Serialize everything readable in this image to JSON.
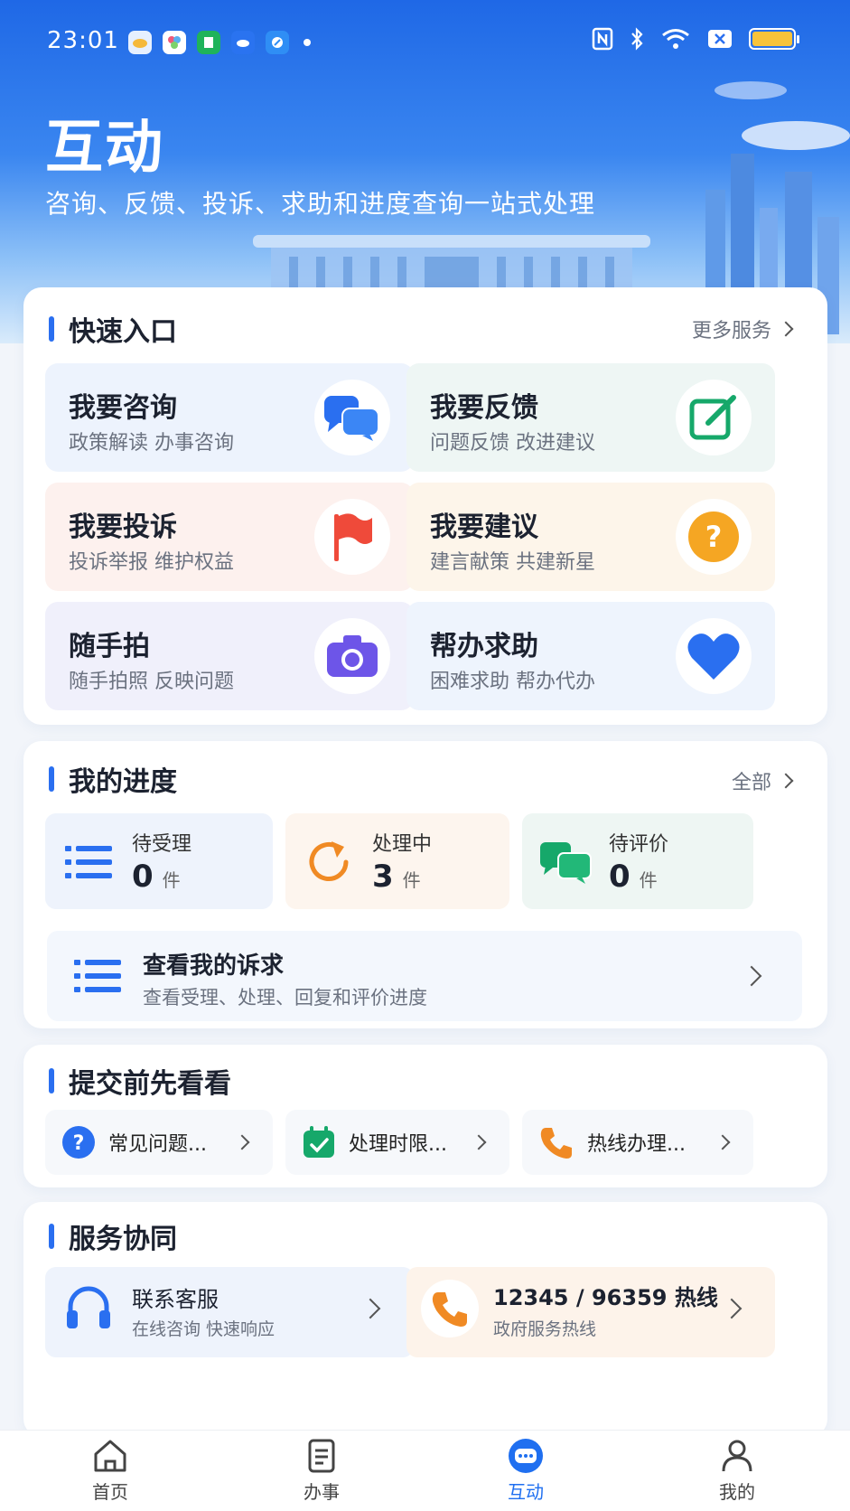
{
  "status": {
    "time": "23:01"
  },
  "header": {
    "title": "互动",
    "subtitle": "咨询、反馈、投诉、求助和进度查询一站式处理"
  },
  "quick": {
    "title": "快速入口",
    "more": "更多服务",
    "items": [
      {
        "title": "我要咨询",
        "sub": "政策解读 办事咨询",
        "icon": "chat-bubbles-icon"
      },
      {
        "title": "我要反馈",
        "sub": "问题反馈 改进建议",
        "icon": "edit-icon"
      },
      {
        "title": "我要投诉",
        "sub": "投诉举报 维护权益",
        "icon": "flag-icon"
      },
      {
        "title": "我要建议",
        "sub": "建言献策 共建新星",
        "icon": "question-icon"
      },
      {
        "title": "随手拍",
        "sub": "随手拍照 反映问题",
        "icon": "camera-icon"
      },
      {
        "title": "帮办求助",
        "sub": "困难求助 帮办代办",
        "icon": "heart-icon"
      }
    ]
  },
  "progress": {
    "title": "我的进度",
    "more": "全部",
    "unit": "件",
    "items": [
      {
        "label": "待受理",
        "count": "0"
      },
      {
        "label": "处理中",
        "count": "3"
      },
      {
        "label": "待评价",
        "count": "0"
      }
    ],
    "view": {
      "title": "查看我的诉求",
      "sub": "查看受理、处理、回复和评价进度"
    }
  },
  "before": {
    "title": "提交前先看看",
    "items": [
      {
        "label": "常见问题..."
      },
      {
        "label": "处理时限..."
      },
      {
        "label": "热线办理..."
      }
    ]
  },
  "service": {
    "title": "服务协同",
    "items": [
      {
        "title": "联系客服",
        "sub": "在线咨询 快速响应"
      },
      {
        "title": "12345 / 96359 热线",
        "sub": "政府服务热线"
      }
    ]
  },
  "tabs": [
    {
      "label": "首页"
    },
    {
      "label": "办事"
    },
    {
      "label": "互动"
    },
    {
      "label": "我的"
    }
  ],
  "colors": {
    "accent": "#1f6ff0",
    "orange": "#f08a24",
    "green": "#16a86a",
    "purple": "#6d55e8",
    "red": "#ef4a3a",
    "yellow": "#f5a623"
  }
}
